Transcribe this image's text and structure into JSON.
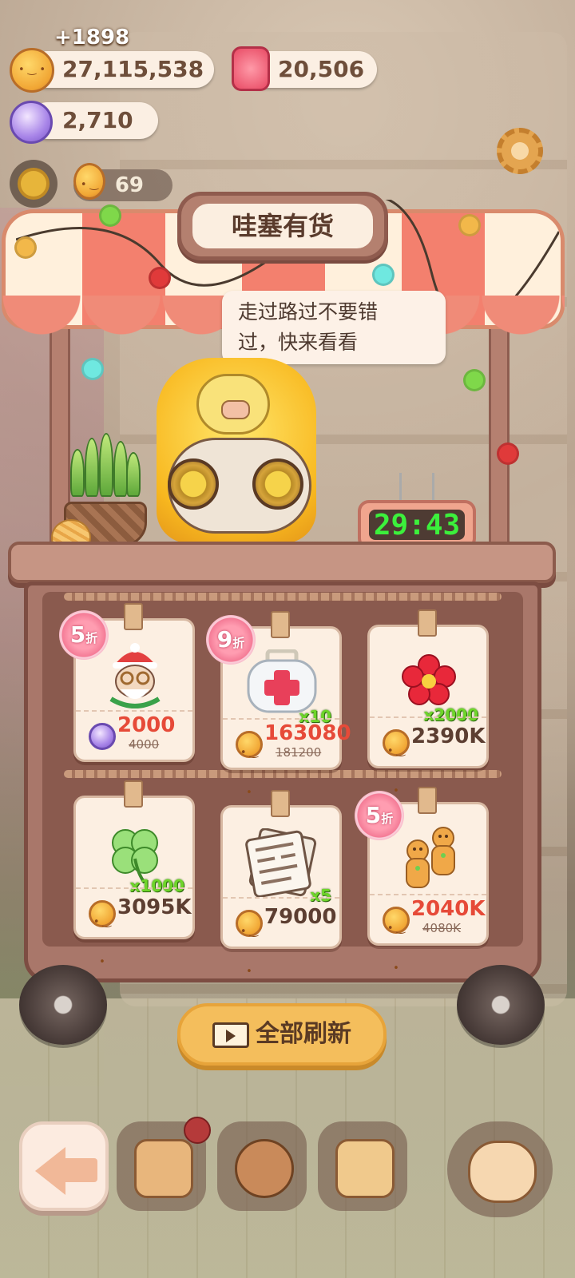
{
  "resources": {
    "gain": "+1898",
    "coins": "27,115,538",
    "candles": "20,506",
    "gems": "2,710",
    "level_count": "69"
  },
  "shop": {
    "title": "哇塞有货",
    "speech_line1": "走过路过不要错",
    "speech_line2": "过，快来看看",
    "timer": "29:43",
    "refresh_label": "全部刷新"
  },
  "items": [
    {
      "name": "christmas-grandpa-outfit",
      "discount_num": "5",
      "discount_unit": "折",
      "qty": "",
      "price": "2000",
      "old_price": "4000",
      "currency": "gem"
    },
    {
      "name": "first-aid-kit",
      "discount_num": "9",
      "discount_unit": "折",
      "qty": "x10",
      "price": "163080",
      "old_price": "181200",
      "currency": "coin"
    },
    {
      "name": "red-flower",
      "discount_num": "",
      "discount_unit": "",
      "qty": "x2000",
      "price": "2390K",
      "old_price": "",
      "currency": "coin"
    },
    {
      "name": "four-leaf-clover",
      "discount_num": "",
      "discount_unit": "",
      "qty": "x1000",
      "price": "3095K",
      "old_price": "",
      "currency": "coin"
    },
    {
      "name": "newspaper",
      "discount_num": "",
      "discount_unit": "",
      "qty": "x5",
      "price": "79000",
      "old_price": "",
      "currency": "coin"
    },
    {
      "name": "gingerbread-cookies",
      "discount_num": "5",
      "discount_unit": "折",
      "qty": "",
      "price": "2040K",
      "old_price": "4080K",
      "currency": "coin"
    }
  ],
  "colors": {
    "accent_price": "#e64a38",
    "qty_green": "#6ed52a",
    "timer_green": "#3cf03c",
    "awning_red": "#f3806e",
    "refresh_yellow": "#f4be5c"
  }
}
